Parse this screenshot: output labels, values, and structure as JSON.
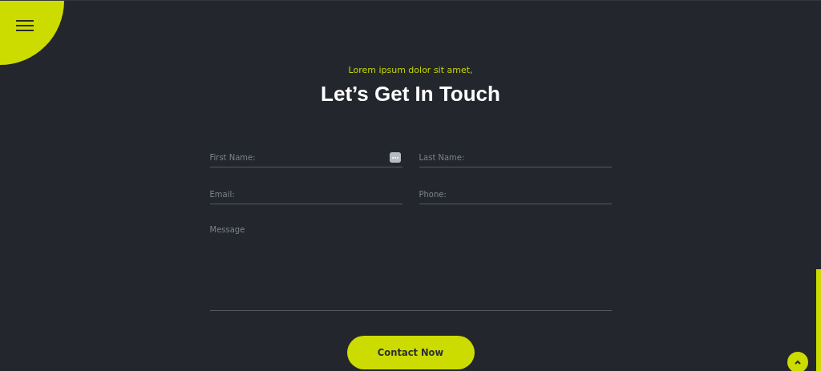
{
  "menu": {
    "kind": "hamburger"
  },
  "header": {
    "subtitle": "Lorem ipsum dolor sit amet,",
    "title": "Let’s Get In Touch"
  },
  "form": {
    "fields": [
      {
        "placeholder": "First Name:",
        "kind": "line",
        "autofill": true
      },
      {
        "placeholder": "Last Name:",
        "kind": "line",
        "autofill": false
      },
      {
        "placeholder": "Email:",
        "kind": "line",
        "autofill": false
      },
      {
        "placeholder": "Phone:",
        "kind": "line",
        "autofill": false
      },
      {
        "placeholder": "Message",
        "kind": "area"
      }
    ],
    "submit": "Contact Now"
  }
}
